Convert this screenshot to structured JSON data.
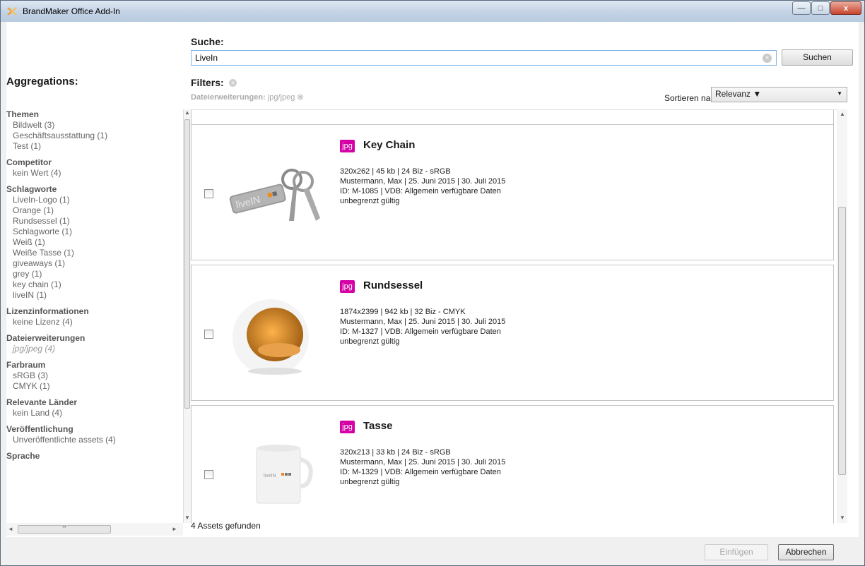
{
  "window": {
    "title": "BrandMaker Office Add-In",
    "minimize": "—",
    "maximize": "□",
    "close": "x"
  },
  "search": {
    "label": "Suche:",
    "value": "LiveIn",
    "button": "Suchen",
    "clear": "×"
  },
  "filters": {
    "label": "Filters:",
    "clear": "×",
    "chip_key": "Dateierweiterungen:",
    "chip_value": "jpg/jpeg",
    "chip_clear": "⊗"
  },
  "sort": {
    "label": "Sortieren nach:",
    "value": "Relevanz ▼"
  },
  "aggregations": {
    "title": "Aggregations:",
    "groups": [
      {
        "title": "Themen",
        "items": [
          "Bildwelt (3)",
          "Geschäftsausstattung (1)",
          "Test (1)"
        ]
      },
      {
        "title": "Competitor",
        "items": [
          "kein Wert (4)"
        ]
      },
      {
        "title": "Schlagworte",
        "items": [
          "LiveIn-Logo (1)",
          "Orange (1)",
          "Rundsessel (1)",
          "Schlagworte (1)",
          "Weiß (1)",
          "Weiße Tasse (1)",
          "giveaways (1)",
          "grey (1)",
          "key chain (1)",
          "liveIN (1)"
        ]
      },
      {
        "title": "Lizenzinformationen",
        "items": [
          "keine Lizenz (4)"
        ]
      },
      {
        "title": "Dateierweiterungen",
        "items": [
          "jpg/jpeg (4)"
        ]
      },
      {
        "title": "Farbraum",
        "items": [
          "sRGB (3)",
          "CMYK (1)"
        ]
      },
      {
        "title": "Relevante Länder",
        "items": [
          "kein Land (4)"
        ]
      },
      {
        "title": "Veröffentlichung",
        "items": [
          "Unveröffentlichte assets (4)"
        ]
      },
      {
        "title": "Sprache",
        "items": []
      }
    ]
  },
  "results": [
    {
      "badge": "jpg",
      "title": "Key Chain",
      "line1": "320x262 | 45 kb | 24 Biz - sRGB",
      "line2": "Mustermann, Max | 25. Juni 2015 | 30. Juli 2015",
      "line3": "ID: M-1085 | VDB: Allgemein verfügbare Daten",
      "line4": "unbegrenzt gültig",
      "logo_text": "liveIN"
    },
    {
      "badge": "jpg",
      "title": "Rundsessel",
      "line1": "1874x2399 | 942 kb | 32 Biz - CMYK",
      "line2": "Mustermann, Max | 25. Juni 2015 | 30. Juli 2015",
      "line3": "ID: M-1327 | VDB: Allgemein verfügbare Daten",
      "line4": "unbegrenzt gültig"
    },
    {
      "badge": "jpg",
      "title": "Tasse",
      "line1": "320x213 | 33 kb | 24 Biz - sRGB",
      "line2": "Mustermann, Max | 25. Juni 2015 | 30. Juli 2015",
      "line3": "ID: M-1329 | VDB: Allgemein verfügbare Daten",
      "line4": "unbegrenzt gültig",
      "logo_text": "liveIN"
    }
  ],
  "status": {
    "found": "4 Assets gefunden"
  },
  "footer": {
    "insert": "Einfügen",
    "cancel": "Abbrechen"
  },
  "colors": {
    "badge": "#d400a5",
    "accent": "#7eb4ea"
  }
}
